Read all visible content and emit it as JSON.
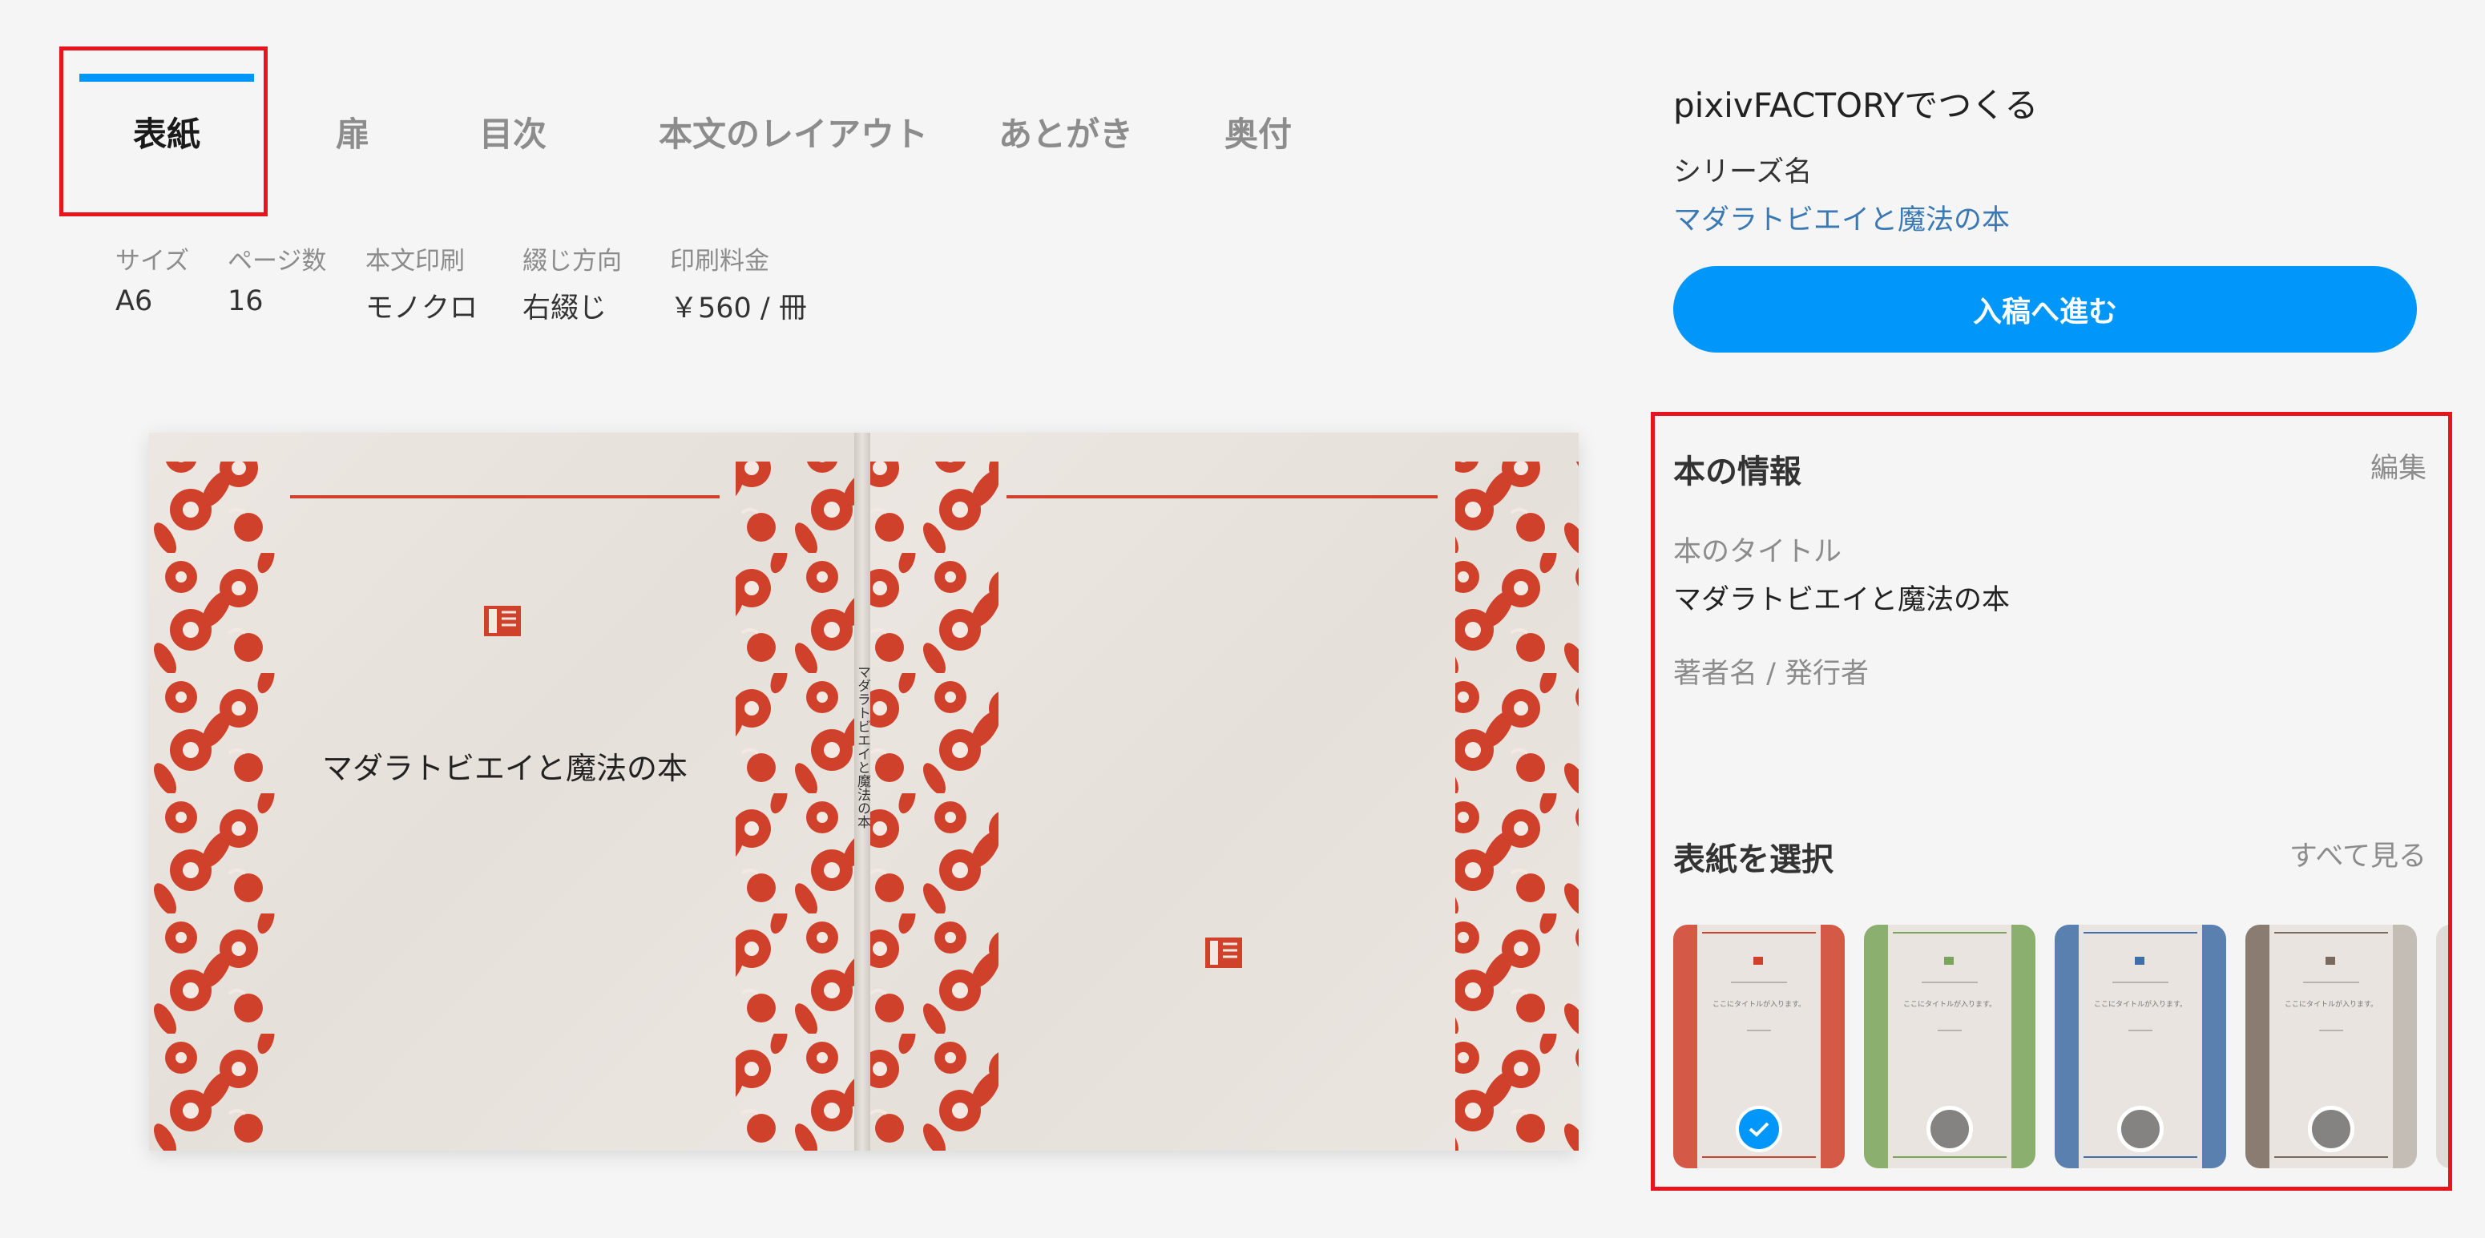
{
  "tabs": [
    {
      "label": "表紙",
      "active": true
    },
    {
      "label": "扉",
      "active": false
    },
    {
      "label": "目次",
      "active": false
    },
    {
      "label": "本文のレイアウト",
      "active": false
    },
    {
      "label": "あとがき",
      "active": false
    },
    {
      "label": "奥付",
      "active": false
    }
  ],
  "specs": [
    {
      "label": "サイズ",
      "value": "A6"
    },
    {
      "label": "ページ数",
      "value": "16"
    },
    {
      "label": "本文印刷",
      "value": "モノクロ"
    },
    {
      "label": "綴じ方向",
      "value": "右綴じ"
    },
    {
      "label": "印刷料金",
      "value": "￥560 / 冊"
    }
  ],
  "preview": {
    "front_title": "マダラトビエイと魔法の本",
    "spine_title": "マダラトビエイと魔法の本"
  },
  "sidebar": {
    "factory_title": "pixivFACTORYでつくる",
    "series_label": "シリーズ名",
    "series_link": "マダラトビエイと魔法の本",
    "proceed_label": "入稿へ進む"
  },
  "book_info": {
    "heading": "本の情報",
    "edit_label": "編集",
    "title_label": "本のタイトル",
    "title_value": "マダラトビエイと魔法の本",
    "author_label": "著者名 / 発行者",
    "author_value": ""
  },
  "cover_select": {
    "heading": "表紙を選択",
    "see_all_label": "すべて見る",
    "thumb_text": "ここにタイトルが入ります。",
    "options": [
      {
        "name": "red",
        "color": "#d0412b",
        "selected": true
      },
      {
        "name": "green",
        "color": "#79a65a",
        "selected": false
      },
      {
        "name": "blue",
        "color": "#3f6fa6",
        "selected": false
      },
      {
        "name": "brown",
        "color": "#7a6a5e",
        "selected": false
      }
    ]
  },
  "colors": {
    "accent": "#0096fa",
    "highlight": "#e8141b",
    "ornament_red": "#d0412b"
  }
}
